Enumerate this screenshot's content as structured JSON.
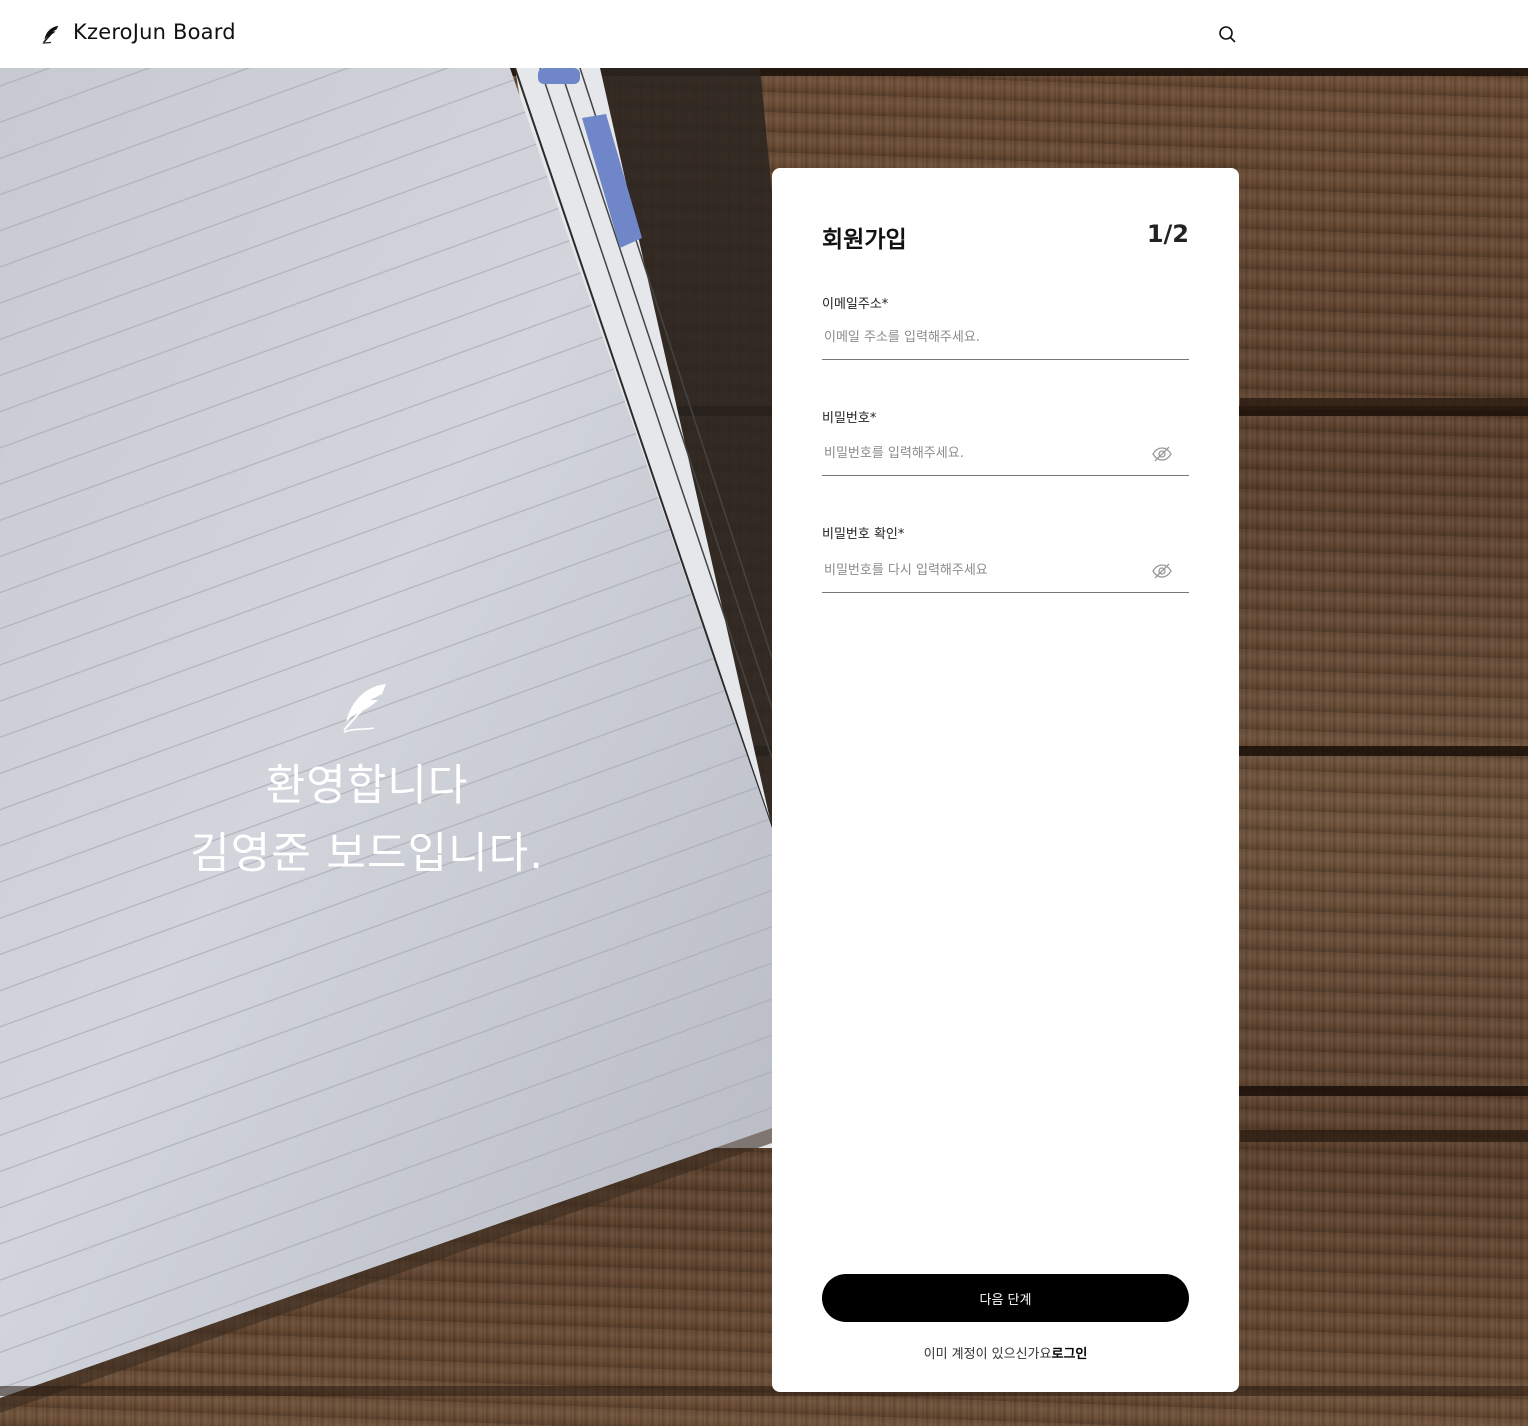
{
  "header": {
    "brand": "KzeroJun Board",
    "logo_icon": "feather-quill-icon",
    "search_icon": "search-icon"
  },
  "hero": {
    "icon": "feather-quill-icon",
    "line1": "환영합니다",
    "line2": "김영준 보드입니다."
  },
  "signup": {
    "title": "회원가입",
    "step": "1/2",
    "email": {
      "label": "이메일주소*",
      "placeholder": "이메일 주소를 입력해주세요.",
      "value": ""
    },
    "password": {
      "label": "비밀번호*",
      "placeholder": "비밀번호를 입력해주세요.",
      "value": "",
      "toggle_icon": "eye-off-icon"
    },
    "password_confirm": {
      "label": "비밀번호 확인*",
      "placeholder": "비밀번호를 다시 입력해주세요",
      "value": "",
      "toggle_icon": "eye-off-icon"
    },
    "next_button": "다음 단계",
    "login_prompt": "이미 계정이 있으신가요",
    "login_link": "로그인"
  },
  "colors": {
    "header_bg": "#ffffff",
    "card_bg": "#ffffff",
    "primary_button": "#000000",
    "wood": "#5b3f2a",
    "paper": "#c9ccd4"
  }
}
